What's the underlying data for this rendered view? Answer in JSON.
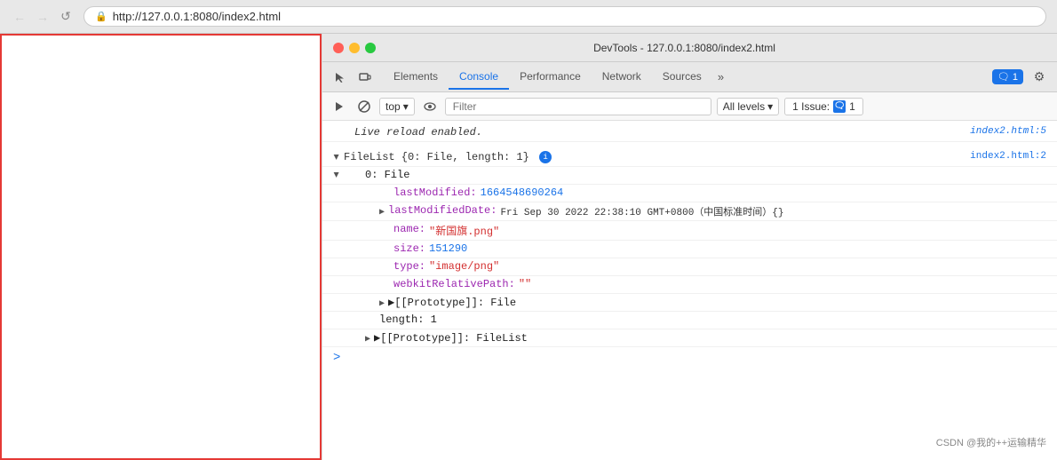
{
  "browser": {
    "back_button": "←",
    "forward_button": "→",
    "refresh_button": "↺",
    "url": "http://127.0.0.1:8080/index2.html",
    "lock_symbol": "🔒"
  },
  "devtools": {
    "title": "DevTools - 127.0.0.1:8080/index2.html",
    "tabs": [
      {
        "label": "Elements",
        "active": false
      },
      {
        "label": "Console",
        "active": true
      },
      {
        "label": "Performance",
        "active": false
      },
      {
        "label": "Network",
        "active": false
      },
      {
        "label": "Sources",
        "active": false
      }
    ],
    "more_label": "»",
    "message_count": "1",
    "message_icon": "🗨",
    "settings_icon": "⚙"
  },
  "console_toolbar": {
    "execute_icon": "▶",
    "ban_icon": "🚫",
    "top_label": "top",
    "dropdown_arrow": "▾",
    "eye_icon": "👁",
    "filter_placeholder": "Filter",
    "levels_label": "All levels",
    "levels_arrow": "▾",
    "issue_label": "1 Issue:",
    "issue_count": "1"
  },
  "console_output": {
    "live_reload": "Live  reload  enabled.",
    "live_reload_link": "index2.html:5",
    "filelist_label": "▼FileList {0: File, length: 1}",
    "filelist_link": "index2.html:2",
    "file_label": "▼0: File",
    "lastModified_key": "lastModified:",
    "lastModified_val": "1664548690264",
    "lastModifiedDate_key": "▶ lastModifiedDate:",
    "lastModifiedDate_val": "Fri Sep 30 2022 22:38:10 GMT+0800（中国标准时间）{}",
    "name_key": "name:",
    "name_val": "\"新国旗.png\"",
    "size_key": "size:",
    "size_val": "151290",
    "type_key": "type:",
    "type_val": "\"image/png\"",
    "webkit_key": "webkitRelativePath:",
    "webkit_val": "\"\"",
    "prototype_file_label": "▶[[Prototype]]: File",
    "length_label": "length: 1",
    "prototype_filelist_label": "▶[[Prototype]]: FileList",
    "prompt_symbol": ">"
  },
  "watermark": {
    "text": "CSDN @我的++运输精华"
  }
}
